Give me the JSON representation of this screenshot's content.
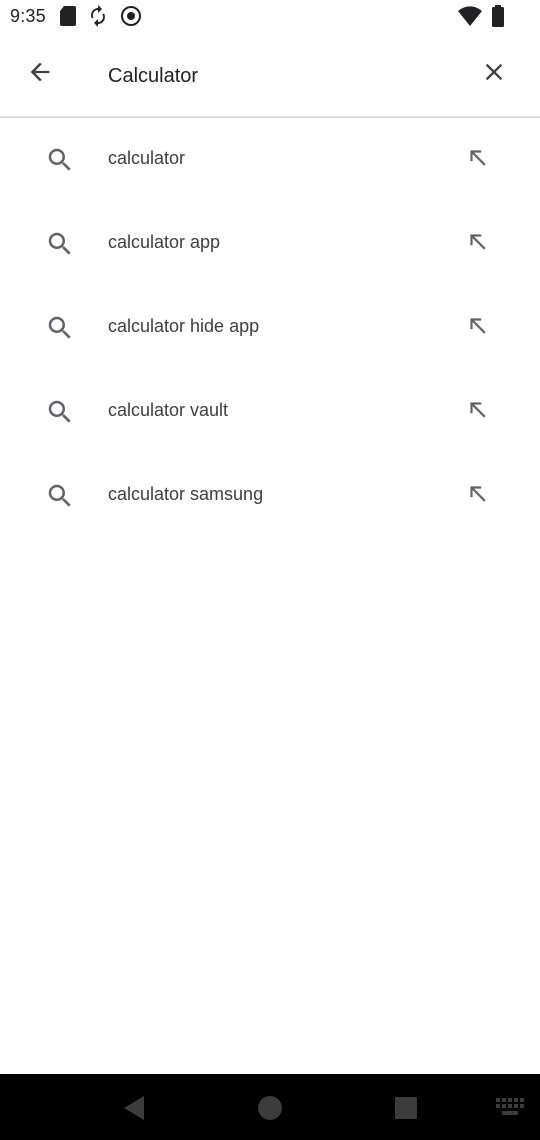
{
  "status_bar": {
    "time": "9:35",
    "left_icons": [
      "sd-card-icon",
      "sync-icon",
      "play-protect-icon"
    ],
    "right_icons": [
      "wifi-icon",
      "battery-icon"
    ]
  },
  "search": {
    "value": "Calculator",
    "back_icon": "arrow-back-icon",
    "clear_icon": "close-icon"
  },
  "suggestions": [
    {
      "label": "calculator"
    },
    {
      "label": "calculator app"
    },
    {
      "label": "calculator hide app"
    },
    {
      "label": "calculator vault"
    },
    {
      "label": "calculator samsung"
    }
  ],
  "nav_bar": {
    "buttons": [
      "back-triangle-icon",
      "home-circle-icon",
      "recents-square-icon",
      "keyboard-icon"
    ]
  },
  "colors": {
    "icon": "#5f6368",
    "text": "#3c4043",
    "divider": "#dadce0",
    "nav_bg": "#000000"
  }
}
